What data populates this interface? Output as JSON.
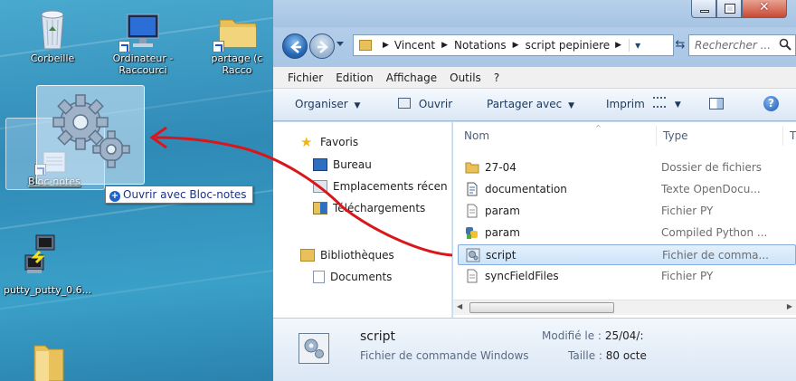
{
  "desktop": {
    "icons": [
      {
        "label_line1": "Corbeille",
        "label_line2": "",
        "icon": "recycle-bin-icon"
      },
      {
        "label_line1": "Ordinateur -",
        "label_line2": "Raccourci",
        "icon": "computer-icon"
      },
      {
        "label_line1": "partage (c",
        "label_line2": "Racco",
        "icon": "folder-icon"
      },
      {
        "label_line1": "Bloc-notes",
        "label_line2": "",
        "icon": "notepad-icon"
      },
      {
        "label_line1": "putty_putty_0.6...",
        "label_line2": "",
        "icon": "putty-icon"
      }
    ],
    "drag_tooltip": "Ouvrir avec Bloc-notes"
  },
  "explorer": {
    "breadcrumb": [
      "Vincent",
      "Notations",
      "script pepiniere"
    ],
    "search_placeholder": "Rechercher ...",
    "menu": [
      "Fichier",
      "Edition",
      "Affichage",
      "Outils",
      "?"
    ],
    "commands": {
      "organize": "Organiser",
      "open": "Ouvrir",
      "share": "Partager avec",
      "print": "Imprim"
    },
    "nav": {
      "favorites_label": "Favoris",
      "favorites": [
        "Bureau",
        "Emplacements récen",
        "Téléchargements"
      ],
      "libraries_label": "Bibliothèques",
      "libraries": [
        "Documents"
      ]
    },
    "columns": {
      "name": "Nom",
      "type": "Type",
      "extra": "T"
    },
    "files": [
      {
        "name": "27-04",
        "type": "Dossier de fichiers",
        "icon": "folder-icon"
      },
      {
        "name": "documentation",
        "type": "Texte OpenDocu...",
        "icon": "document-icon"
      },
      {
        "name": "param",
        "type": "Fichier PY",
        "icon": "python-file-icon"
      },
      {
        "name": "param",
        "type": "Compiled Python ...",
        "icon": "compiled-python-icon"
      },
      {
        "name": "script",
        "type": "Fichier de comma...",
        "icon": "batch-file-icon",
        "selected": true
      },
      {
        "name": "syncFieldFiles",
        "type": "Fichier PY",
        "icon": "python-file-icon"
      }
    ],
    "details": {
      "name": "script",
      "kind": "Fichier de commande Windows",
      "modified_label": "Modifié le :",
      "modified_value": "25/04/:",
      "size_label": "Taille :",
      "size_value": "80 octe"
    }
  },
  "colors": {
    "desktop_bg": "#3e9cc4",
    "arrow": "#d8161b",
    "selection": "#cde4fa",
    "link_text": "#1e3287"
  }
}
